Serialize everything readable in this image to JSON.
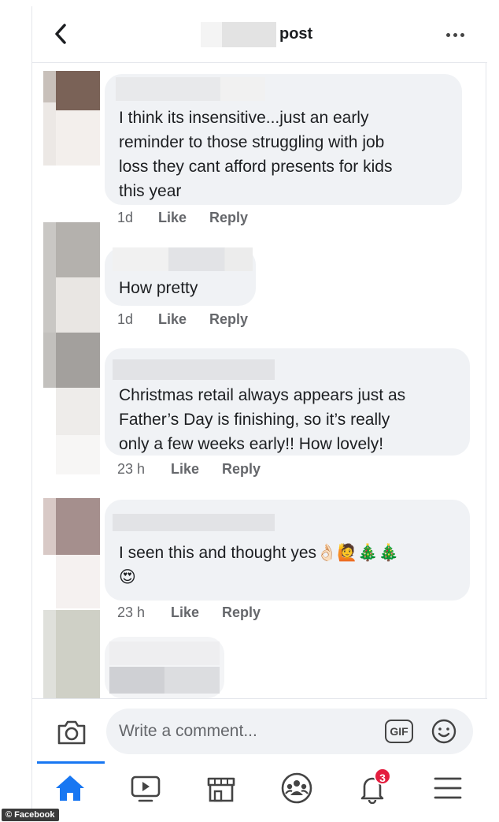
{
  "header": {
    "title": "post"
  },
  "comments": [
    {
      "text": "I think its insensitive...just an early\nreminder to those struggling with job\nloss they cant afford presents for kids\nthis year",
      "time": "1d",
      "like": "Like",
      "reply": "Reply"
    },
    {
      "text": "How pretty",
      "time": "1d",
      "like": "Like",
      "reply": "Reply"
    },
    {
      "text": "Christmas retail always appears just as\nFather’s Day is finishing, so it’s really\nonly a few weeks early!! How lovely!",
      "time": "23 h",
      "like": "Like",
      "reply": "Reply"
    },
    {
      "text": "I seen this and thought yes👌🏻🙋🎄🎄\n😍",
      "time": "23 h",
      "like": "Like",
      "reply": "Reply"
    }
  ],
  "composer": {
    "placeholder": "Write a comment...",
    "gif_label": "GIF"
  },
  "tabbar": {
    "notifications_badge": "3"
  },
  "credit": "© Facebook",
  "colors": {
    "accent": "#1877f2",
    "bubble": "#f0f2f5",
    "meta": "#65676b",
    "badge": "#e41e3f"
  },
  "icons": [
    "back-chevron-icon",
    "more-dots-icon",
    "camera-icon",
    "gif-icon",
    "emoji-icon",
    "home-icon",
    "video-icon",
    "marketplace-icon",
    "groups-icon",
    "bell-icon",
    "menu-icon"
  ]
}
